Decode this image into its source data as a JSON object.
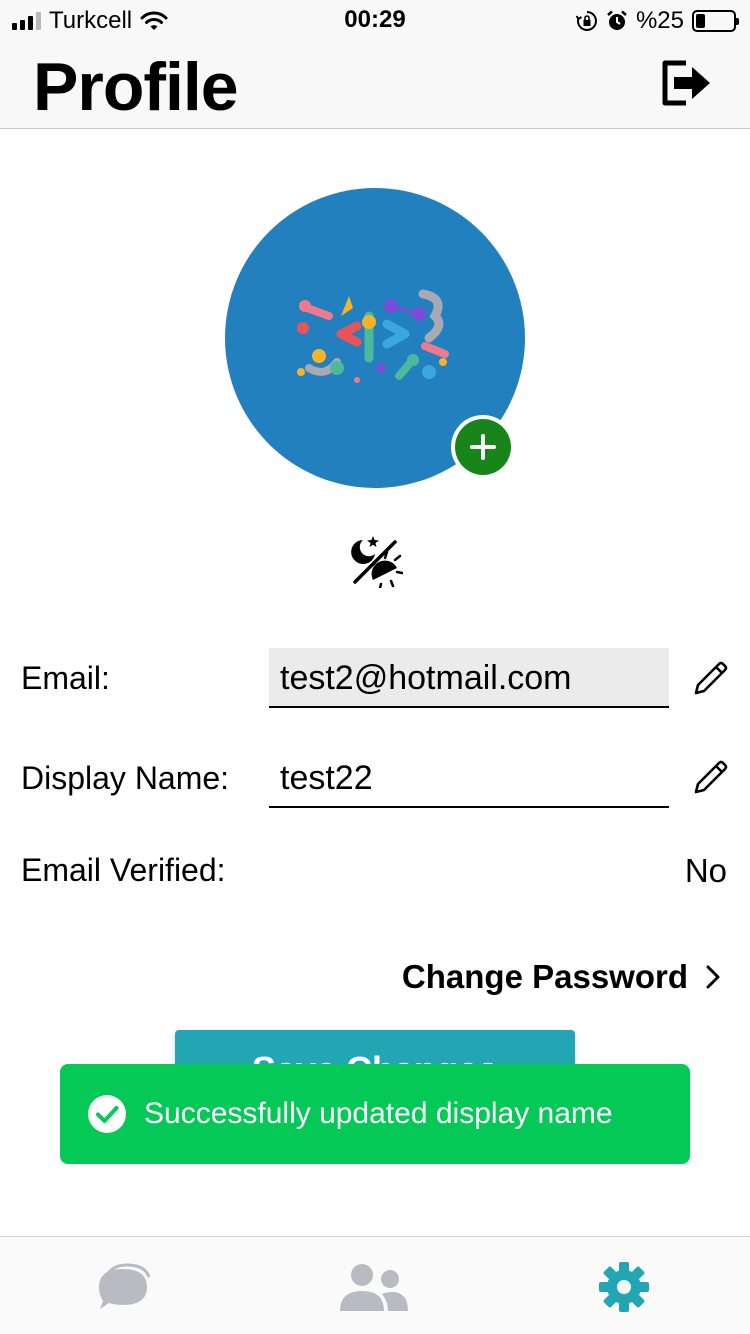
{
  "status_bar": {
    "carrier": "Turkcell",
    "time": "00:29",
    "battery_text": "%25",
    "battery_level": 0.25
  },
  "header": {
    "title": "Profile"
  },
  "form": {
    "email_label": "Email:",
    "email_value": "test2@hotmail.com",
    "display_name_label": "Display Name:",
    "display_name_value": "test22",
    "email_verified_label": "Email Verified:",
    "email_verified_value": "No"
  },
  "actions": {
    "change_password_label": "Change Password",
    "save_changes_label": "Save Changes"
  },
  "toast": {
    "message": "Successfully updated display name"
  },
  "colors": {
    "avatar_bg": "#2280bf",
    "add_button": "#17851a",
    "save_button": "#22a6b3",
    "toast_bg": "#05c957",
    "active_tab": "#22a6b3",
    "inactive_tab": "#b8bcc2"
  },
  "tabs": [
    {
      "icon": "chat-bubbles-icon",
      "active": false
    },
    {
      "icon": "users-icon",
      "active": false
    },
    {
      "icon": "gear-icon",
      "active": true
    }
  ]
}
